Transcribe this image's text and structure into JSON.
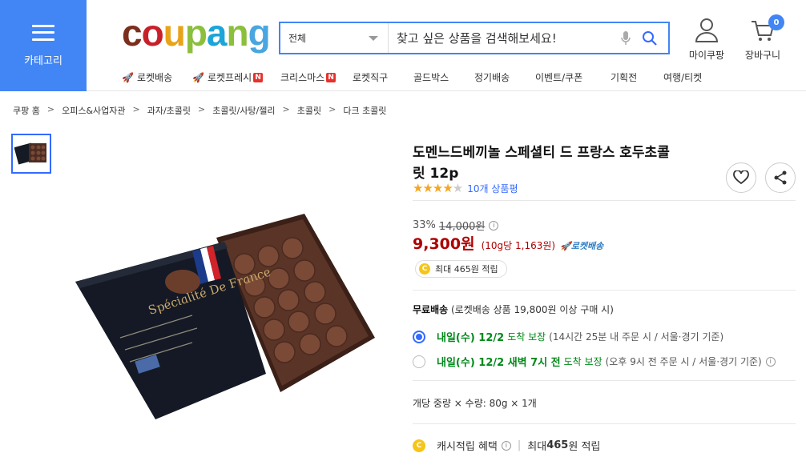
{
  "header": {
    "category_label": "카테고리",
    "logo_text": "coupang",
    "search": {
      "category": "전체",
      "placeholder": "찾고 싶은 상품을 검색해보세요!"
    },
    "mypage_label": "마이쿠팡",
    "cart_label": "장바구니",
    "cart_count": "0"
  },
  "nav": [
    {
      "label": "로켓배송",
      "rocket": true,
      "badge": ""
    },
    {
      "label": "로켓프레시",
      "rocket": true,
      "badge": "N"
    },
    {
      "label": "크리스마스",
      "rocket": false,
      "badge": "N"
    },
    {
      "label": "로켓직구",
      "rocket": false,
      "badge": ""
    },
    {
      "label": "골드박스",
      "rocket": false,
      "badge": ""
    },
    {
      "label": "정기배송",
      "rocket": false,
      "badge": ""
    },
    {
      "label": "이벤트/쿠폰",
      "rocket": false,
      "badge": ""
    },
    {
      "label": "기획전",
      "rocket": false,
      "badge": ""
    },
    {
      "label": "여행/티켓",
      "rocket": false,
      "badge": ""
    }
  ],
  "breadcrumb": [
    "쿠팡 홈",
    "오피스&사업자관",
    "과자/초콜릿",
    "초콜릿/사탕/젤리",
    "초콜릿",
    "다크 초콜릿"
  ],
  "product": {
    "title_line1": "도멘느드베끼놀 스페셜티 드 프랑스 호두초콜",
    "title_line2": "릿 12p",
    "rating": 4,
    "review_count": "10개 상품평",
    "discount": "33%",
    "original_price": "14,000원",
    "sale_price": "9,300원",
    "unit_price": "(10g당 1,163원)",
    "rocket_tag": "로켓배송",
    "cash_badge": "최대 465원 적립",
    "box_text": "Spécialité De France"
  },
  "shipping": {
    "title_bold": "무료배송",
    "title_rest": " (로켓배송 상품 19,800원 이상 구매 시)",
    "options": [
      {
        "date": "내일(수) 12/2",
        "extra": "",
        "guarantee": "도착 보장",
        "note": "(14시간 25분 내 주문 시 / 서울·경기 기준)",
        "selected": true
      },
      {
        "date": "내일(수) 12/2 새벽 7시 전",
        "extra": "",
        "guarantee": "도착 보장",
        "note": "(오후 9시 전 주문 시 / 서울·경기 기준)",
        "selected": false
      }
    ]
  },
  "unit_info": "개당 중량 × 수량: 80g × 1개",
  "cash_benefit": {
    "label": "캐시적립 혜택",
    "detail_prefix": "최대 ",
    "amount": "465",
    "detail_suffix": "원 적립"
  },
  "colors": {
    "accent": "#4285f4",
    "price": "#ae0000",
    "green": "#00891a",
    "link": "#346aff"
  }
}
